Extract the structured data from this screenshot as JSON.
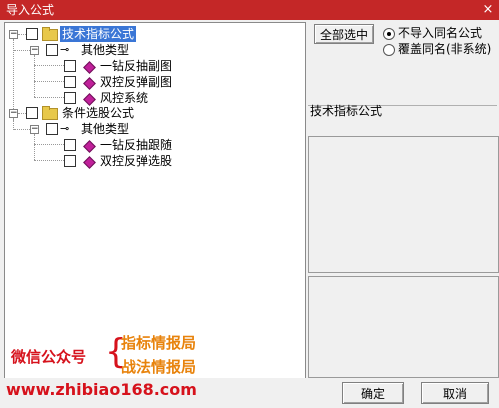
{
  "window": {
    "title": "导入公式",
    "close_icon": "×"
  },
  "tree": {
    "root1": {
      "label": "技术指标公式",
      "expander": "−"
    },
    "root1_child": {
      "label": "其他类型",
      "expander": "−"
    },
    "root1_items": [
      "一钻反抽副图",
      "双控反弹副图",
      "风控系统"
    ],
    "root2": {
      "label": "条件选股公式",
      "expander": "−"
    },
    "root2_child": {
      "label": "其他类型",
      "expander": "−"
    },
    "root2_items": [
      "一钻反抽跟随",
      "双控反弹选股"
    ]
  },
  "right": {
    "select_all": "全部选中",
    "radio_options": [
      "不导入同名公式",
      "覆盖同名(非系统)"
    ],
    "selected_radio": 0,
    "info_label": "技术指标公式"
  },
  "footer": {
    "ok": "确定",
    "cancel": "取消"
  },
  "watermark": {
    "wechat": "微信公众号",
    "brace": "{",
    "line1": "指标情报局",
    "line2": "战法情报局",
    "url": "www.zhibiao168.com"
  },
  "colors": {
    "title_bar": "#c42727",
    "selection": "#3a76d6",
    "watermark_red": "#d6121c",
    "watermark_orange": "#e8830c"
  }
}
